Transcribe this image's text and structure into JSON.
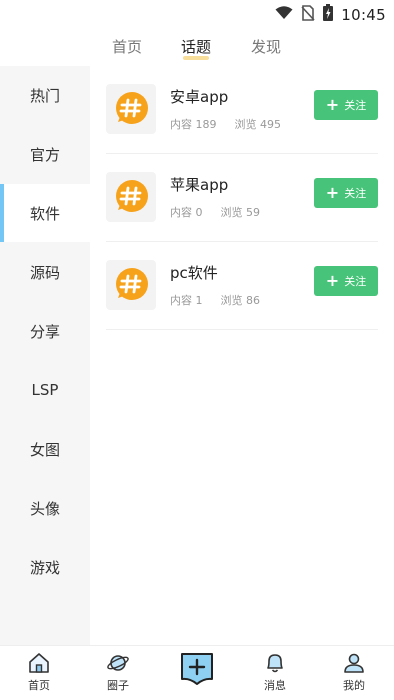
{
  "status_bar": {
    "time": "10:45",
    "icons": [
      "wifi-icon",
      "no-sim-icon",
      "battery-charging-icon"
    ]
  },
  "top_tabs": [
    {
      "label": "首页",
      "active": false
    },
    {
      "label": "话题",
      "active": true
    },
    {
      "label": "发现",
      "active": false
    }
  ],
  "sidebar": {
    "items": [
      {
        "label": "热门"
      },
      {
        "label": "官方"
      },
      {
        "label": "软件"
      },
      {
        "label": "源码"
      },
      {
        "label": "分享"
      },
      {
        "label": "LSP"
      },
      {
        "label": "女图"
      },
      {
        "label": "头像"
      },
      {
        "label": "游戏"
      }
    ],
    "active_index": 2,
    "indicator_color": "#74c6f5"
  },
  "topics": [
    {
      "name": "安卓app",
      "content_label": "内容 189",
      "views_label": "浏览 495",
      "follow_label": "关注",
      "icon": "hashtag-bubble-icon"
    },
    {
      "name": "苹果app",
      "content_label": "内容 0",
      "views_label": "浏览 59",
      "follow_label": "关注",
      "icon": "hashtag-bubble-icon"
    },
    {
      "name": "pc软件",
      "content_label": "内容 1",
      "views_label": "浏览 86",
      "follow_label": "关注",
      "icon": "hashtag-bubble-icon"
    }
  ],
  "bottom_nav": {
    "items": [
      {
        "label": "首页",
        "icon": "home-icon"
      },
      {
        "label": "圈子",
        "icon": "planet-icon"
      },
      {
        "label": "",
        "icon": "add-post-icon"
      },
      {
        "label": "消息",
        "icon": "bell-icon"
      },
      {
        "label": "我的",
        "icon": "user-icon"
      }
    ]
  },
  "colors": {
    "accent_green": "#47c479",
    "sidebar_bg": "#f6f6f6",
    "tab_underline": "#f6d88a",
    "topic_icon_orange": "#f7a21b"
  }
}
